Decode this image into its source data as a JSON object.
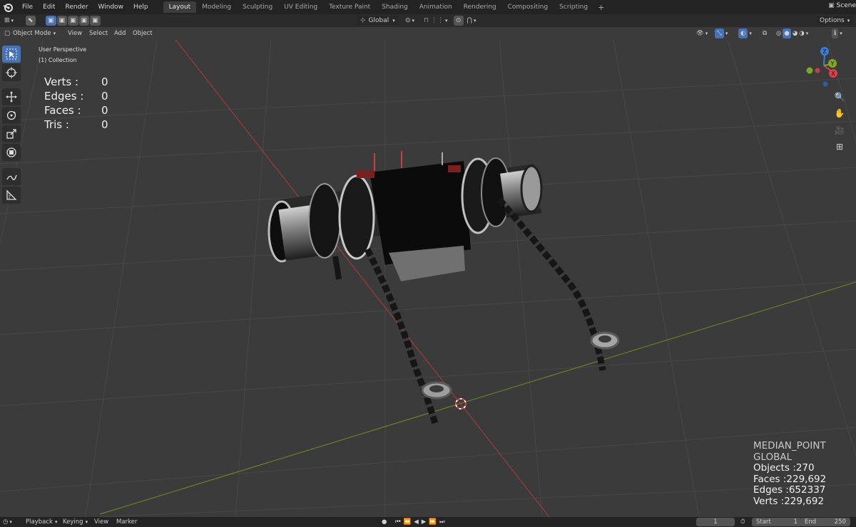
{
  "topbar": {
    "menus": [
      "File",
      "Edit",
      "Render",
      "Window",
      "Help"
    ],
    "workspaces": [
      "Layout",
      "Modeling",
      "Sculpting",
      "UV Editing",
      "Texture Paint",
      "Shading",
      "Animation",
      "Rendering",
      "Compositing",
      "Scripting"
    ],
    "active_workspace": "Layout",
    "scene_label": "Scene"
  },
  "header": {
    "transform_orientation": "Global",
    "options_label": "Options"
  },
  "viewport_menu": {
    "mode": "Object Mode",
    "items": [
      "View",
      "Select",
      "Add",
      "Object"
    ]
  },
  "viewport_info": {
    "view_name": "User Perspective",
    "collection": "(1) Collection"
  },
  "mesh_stats": [
    {
      "label": "Verts :",
      "value": "0"
    },
    {
      "label": "Edges :",
      "value": "0"
    },
    {
      "label": "Faces :",
      "value": "0"
    },
    {
      "label": "Tris :",
      "value": "0"
    }
  ],
  "scene_stats": {
    "pivot": "MEDIAN_POINT",
    "orientation": "GLOBAL",
    "objects": "Objects :270",
    "faces": "Faces :229,692",
    "edges": "Edges :652337",
    "verts": "Verts :229,692"
  },
  "gizmo": {
    "x_label": "X",
    "y_label": "Y",
    "z_label": "Z",
    "x_color": "#e0404e",
    "y_color": "#7fa81e",
    "z_color": "#3a7fd6"
  },
  "timeline": {
    "menus": [
      "Playback",
      "Keying",
      "View",
      "Marker"
    ],
    "current_frame": "1",
    "start_label": "Start",
    "start_value": "1",
    "end_label": "End",
    "end_value": "250"
  },
  "colors": {
    "accent": "#4772b3",
    "x_axis": "#c03838",
    "y_axis": "#7a9a22"
  }
}
